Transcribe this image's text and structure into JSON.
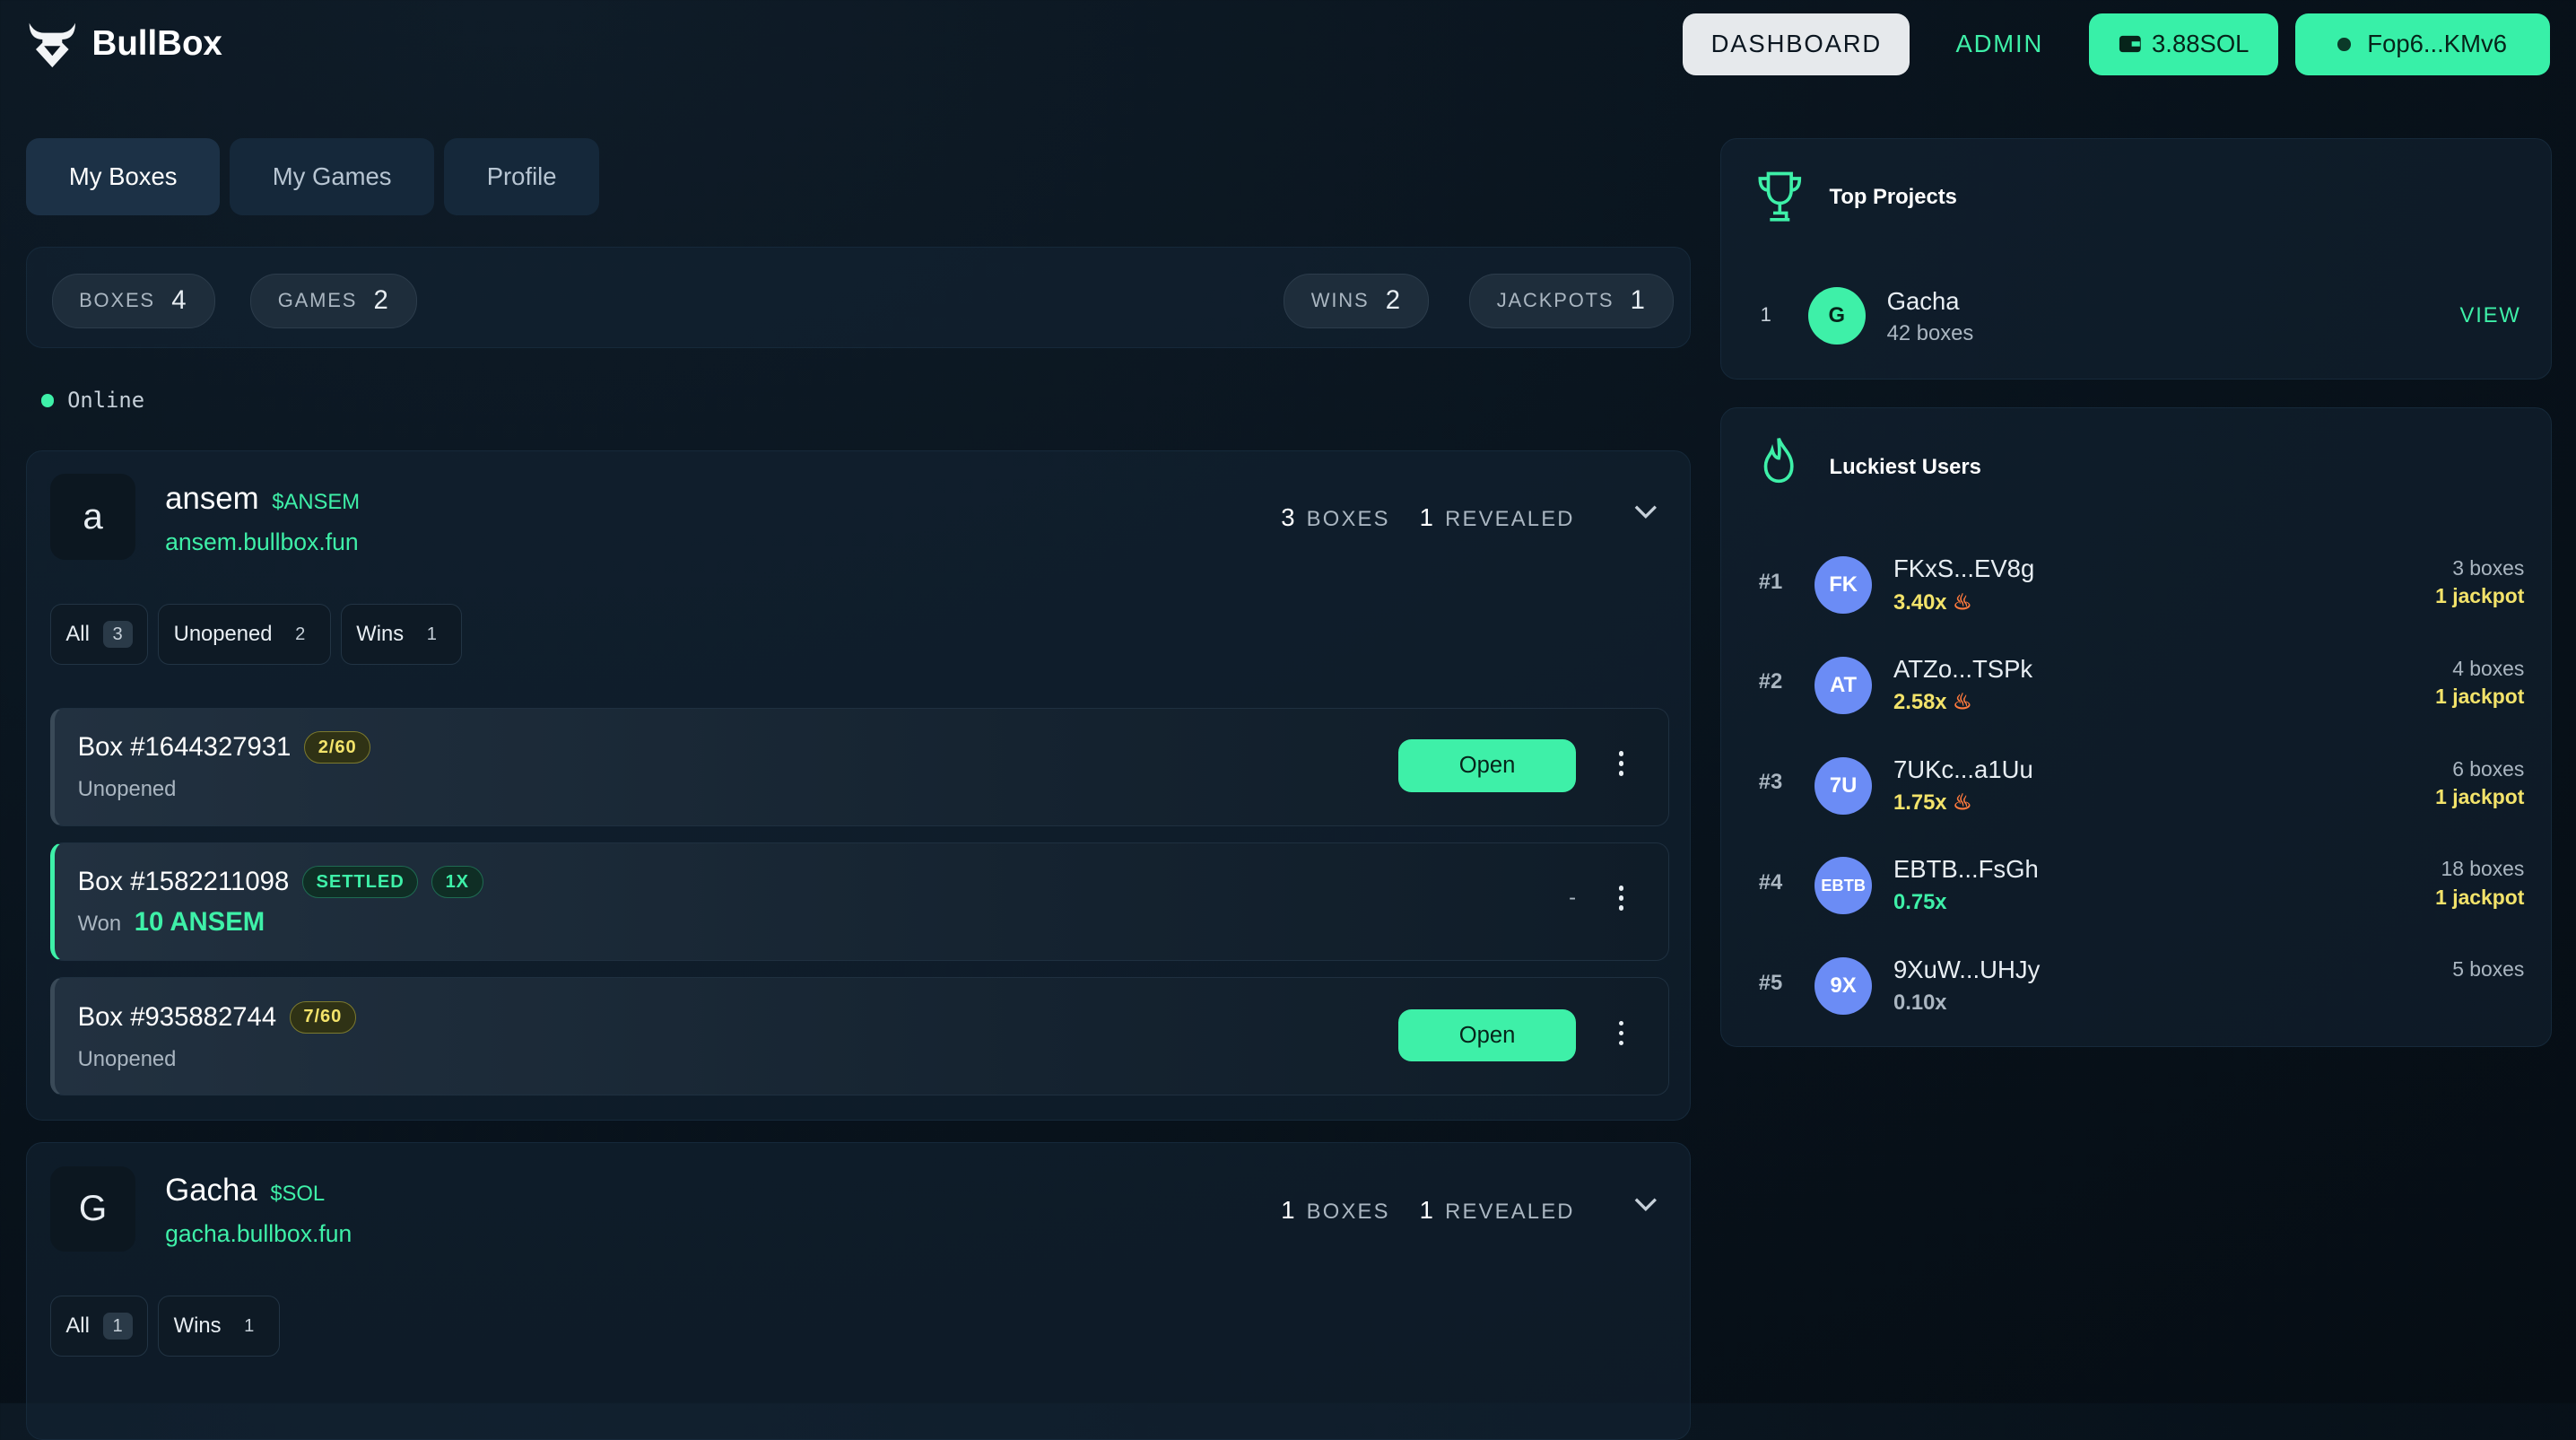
{
  "brand": {
    "name": "BullBox"
  },
  "nav": {
    "dashboard": "DASHBOARD",
    "admin": "ADMIN",
    "balance": "3.88SOL",
    "wallet": "Fop6...KMv6"
  },
  "tabs": [
    "My Boxes",
    "My Games",
    "Profile"
  ],
  "stats": [
    {
      "label": "BOXES",
      "value": "4"
    },
    {
      "label": "GAMES",
      "value": "2"
    },
    {
      "label": "WINS",
      "value": "2"
    },
    {
      "label": "JACKPOTS",
      "value": "1"
    }
  ],
  "status": "Online",
  "projects": [
    {
      "initial": "a",
      "name": "ansem",
      "ticker": "$ANSEM",
      "url": "ansem.bullbox.fun",
      "boxes": "3",
      "boxes_label": "BOXES",
      "revealed": "1",
      "revealed_label": "REVEALED",
      "filters": [
        {
          "label": "All",
          "count": "3"
        },
        {
          "label": "Unopened",
          "count": "2"
        },
        {
          "label": "Wins",
          "count": "1"
        }
      ],
      "items": [
        {
          "title": "Box #1644327931",
          "badge": "2/60",
          "sub": "Unopened",
          "action": "Open"
        },
        {
          "title": "Box #1582211098",
          "badge": "SETTLED",
          "badge2": "1X",
          "sub": "Won",
          "won": "10 ANSEM",
          "action": "-"
        },
        {
          "title": "Box #935882744",
          "badge": "7/60",
          "sub": "Unopened",
          "action": "Open"
        }
      ]
    },
    {
      "initial": "G",
      "name": "Gacha",
      "ticker": "$SOL",
      "url": "gacha.bullbox.fun",
      "boxes": "1",
      "boxes_label": "BOXES",
      "revealed": "1",
      "revealed_label": "REVEALED",
      "filters": [
        {
          "label": "All",
          "count": "1"
        },
        {
          "label": "Wins",
          "count": "1"
        }
      ]
    }
  ],
  "top_projects": {
    "title": "Top Projects",
    "items": [
      {
        "rank": "1",
        "initial": "G",
        "name": "Gacha",
        "boxes": "42 boxes",
        "action": "VIEW"
      }
    ]
  },
  "luckiest": {
    "title": "Luckiest Users",
    "users": [
      {
        "rank": "#1",
        "initials": "FK",
        "name": "FKxS...EV8g",
        "mult": "3.40x",
        "boxes": "3 boxes",
        "jackpot": "1 jackpot"
      },
      {
        "rank": "#2",
        "initials": "AT",
        "name": "ATZo...TSPk",
        "mult": "2.58x",
        "boxes": "4 boxes",
        "jackpot": "1 jackpot"
      },
      {
        "rank": "#3",
        "initials": "7U",
        "name": "7UKc...a1Uu",
        "mult": "1.75x",
        "boxes": "6 boxes",
        "jackpot": "1 jackpot"
      },
      {
        "rank": "#4",
        "initials": "EBTB",
        "name": "EBTB...FsGh",
        "mult": "0.75x",
        "boxes": "18 boxes",
        "jackpot": "1 jackpot"
      },
      {
        "rank": "#5",
        "initials": "9X",
        "name": "9XuW...UHJy",
        "mult": "0.10x",
        "boxes": "5 boxes",
        "jackpot": ""
      }
    ]
  }
}
